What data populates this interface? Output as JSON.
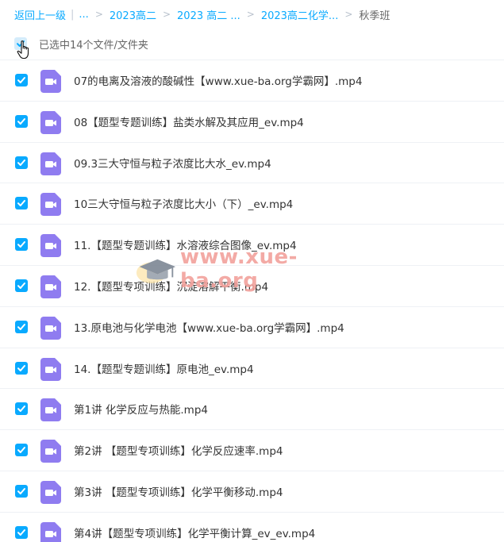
{
  "breadcrumb": {
    "back": "返回上一级",
    "sep": "|",
    "ellipsis": "...",
    "arrow": ">",
    "items": [
      "2023高二",
      "2023 高二 ...",
      "2023高二化学..."
    ],
    "current": "秋季班"
  },
  "selection": {
    "label": "已选中14个文件/文件夹"
  },
  "files": [
    {
      "name": "07的电离及溶液的酸碱性【www.xue-ba.org学霸网】.mp4"
    },
    {
      "name": "08【题型专题训练】盐类水解及其应用_ev.mp4"
    },
    {
      "name": "09.3三大守恒与粒子浓度比大水_ev.mp4"
    },
    {
      "name": "10三大守恒与粒子浓度比大小（下）_ev.mp4"
    },
    {
      "name": "11.【题型专题训练】水溶液综合图像_ev.mp4"
    },
    {
      "name": "12.【题型专项训练】沉淀溶解平衡.mp4"
    },
    {
      "name": "13.原电池与化学电池【www.xue-ba.org学霸网】.mp4"
    },
    {
      "name": "14.【题型专题训练】原电池_ev.mp4"
    },
    {
      "name": "第1讲 化学反应与热能.mp4"
    },
    {
      "name": "第2讲 【题型专项训练】化学反应速率.mp4"
    },
    {
      "name": "第3讲 【题型专项训练】化学平衡移动.mp4"
    },
    {
      "name": "第4讲【题型专项训练】化学平衡计算_ev_ev.mp4"
    }
  ],
  "watermark": {
    "text": "www.xue-ba.org"
  },
  "colors": {
    "accent": "#09aaff",
    "video_icon": "#8f7cf0",
    "watermark": "#f2a19c"
  },
  "icons": {
    "file": "video-file-icon",
    "check": "checkmark-icon",
    "cursor": "hand-pointer-icon"
  }
}
